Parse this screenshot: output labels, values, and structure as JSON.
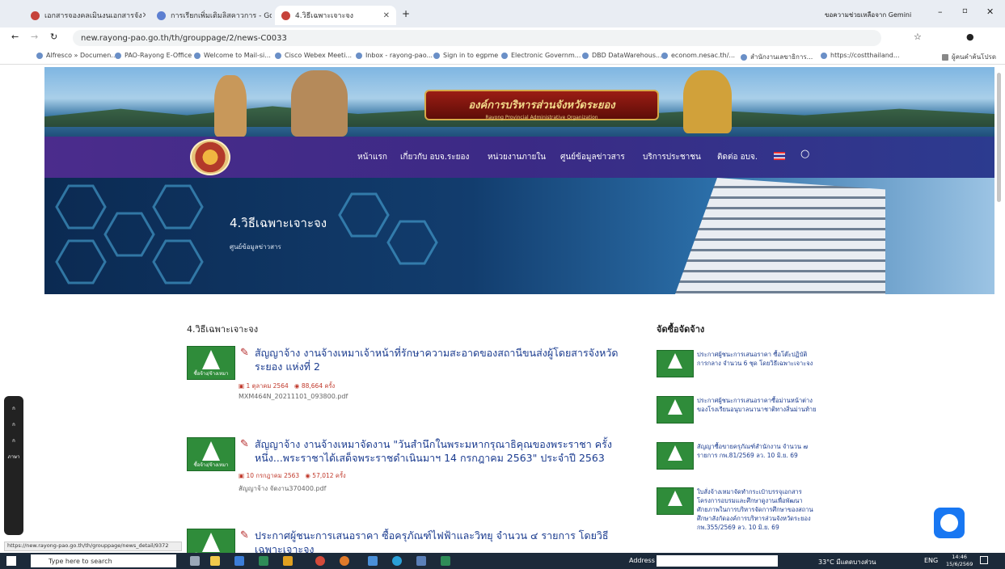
{
  "browser": {
    "tabs": [
      {
        "label": "เอกสารจองคลเมินงนเอกสารจัง"
      },
      {
        "label": "การเรียกเพิ่มเติมลิสคาวการ - Goo"
      },
      {
        "label": "4.วิธีเฉพาะเจาะจง"
      }
    ],
    "gemini_label": "ขอความช่วยเหลือจาก Gemini",
    "url": "new.rayong-pao.go.th/th/grouppage/2/news-C0033",
    "bookmarks": [
      "Alfresco » Documen...",
      "PAO-Rayong E-Office",
      "Welcome to Mail-si...",
      "Cisco Webex Meeti...",
      "Inbox - rayong-pao...",
      "Sign in to egpme",
      "Electronic Governm...",
      "DBD DataWarehous...",
      "econom.nesac.th/...",
      "สำนักงานเลขาธิการ...",
      "https://costthailand...",
      "ผู้คนคำค้นโปรด"
    ]
  },
  "banner": {
    "org_name": "องค์การบริหารส่วนจังหวัดระยอง",
    "org_name_en": "Rayong Provincial Administrative Organization"
  },
  "nav": {
    "items": [
      "หน้าแรก",
      "เกี่ยวกับ อบจ.ระยอง",
      "หน่วยงานภายใน",
      "ศูนย์ข้อมูลข่าวสาร",
      "บริการประชาชน",
      "ติดต่อ อบจ."
    ]
  },
  "hero": {
    "title": "4.วิธีเฉพาะเจาะจง",
    "subtitle": "ศูนย์ข้อมูลข่าวสาร"
  },
  "main": {
    "section_title": "4.วิธีเฉพาะเจาะจง",
    "thumb_label": "ซื้อจ้าง/จ้างเหมา",
    "posts": [
      {
        "title": "สัญญาจ้าง งานจ้างเหมาเจ้าหน้าที่รักษาความสะอาดของสถานีขนส่งผู้โดยสารจังหวัดระยอง แห่งที่ 2",
        "date": "1 ตุลาคม 2564",
        "views": "88,664 ครั้ง",
        "file": "MXM464N_20211101_093800.pdf"
      },
      {
        "title": "สัญญาจ้าง งานจ้างเหมาจัดงาน \"วันสำนึกในพระมหากรุณาธิคุณของพระราชา ครั้งหนึ่ง...พระราชาได้เสด็จพระราชดำเนินมาฯ 14 กรกฎาคม 2563\" ประจำปี 2563",
        "date": "10 กรกฎาคม 2563",
        "views": "57,012 ครั้ง",
        "file": "สัญญาจ้าง จัดงาน370400.pdf"
      },
      {
        "title": "ประกาศผู้ชนะการเสนอราคา ซื้อครุภัณฑ์ไฟฟ้าและวิทยุ จำนวน ๔ รายการ โดยวิธีเฉพาะเจาะจง",
        "date": "",
        "views": "",
        "file": ""
      }
    ]
  },
  "sidebar": {
    "title": "จัดซื้อจัดจ้าง",
    "items": [
      "ประกาศผู้ชนะการเสนอราคา ซื้อโต๊ะปฏิบัติการกลาง จำนวน 6 ชุด โดยวิธีเฉพาะเจาะจง",
      "ประกาศผู้ชนะการเสนอราคาซื้อม่านหน้าต่างของโรงเรียนอนุบาลนานาชาติทางสิ่นม่านท้าย",
      "สัญญาซื้อขายครุภัณฑ์สำนักงาน จำนวน ๗ รายการ กพ.81/2569 ลว. 10 มิ.ย. 69",
      "ใบสั่งจ้างเหมาจัดทำกระเป๋าบรรจุเอกสาร โครงการอบรมและศึกษาดูงานเพื่อพัฒนาศักยภาพในการบริหารจัดการศึกษาของสถานศึกษาสังกัดองค์การบริหารส่วนจังหวัดระยอง กพ.355/2569 ลว. 10 มิ.ย. 69"
    ]
  },
  "accessibility": {
    "label": "ภาษา"
  },
  "status_url": "https://new.rayong-pao.go.th/th/grouppage/news_detail/9372",
  "taskbar": {
    "search_placeholder": "Type here to search",
    "address_label": "Address",
    "weather": "33°C มีแดดบางส่วน",
    "lang": "ENG",
    "time": "14:46",
    "date": "15/6/2569"
  }
}
